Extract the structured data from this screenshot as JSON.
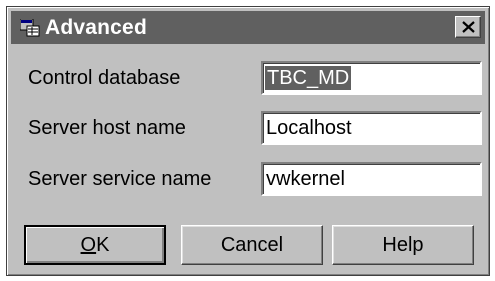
{
  "window": {
    "title": "Advanced"
  },
  "titlebar": {
    "close_label": "X"
  },
  "form": {
    "fields": [
      {
        "label": "Control database",
        "value": "TBC_MD"
      },
      {
        "label": "Server host name",
        "value": "Localhost"
      },
      {
        "label": "Server service name",
        "value": "vwkernel"
      }
    ]
  },
  "buttons": {
    "ok_first": "O",
    "ok_rest": "K",
    "cancel": "Cancel",
    "help": "Help"
  },
  "colors": {
    "titlebar": "#606060",
    "face": "#c0c0c0",
    "selection": "#606060"
  },
  "icons": {
    "app": "database-window-icon",
    "close": "close-icon"
  }
}
